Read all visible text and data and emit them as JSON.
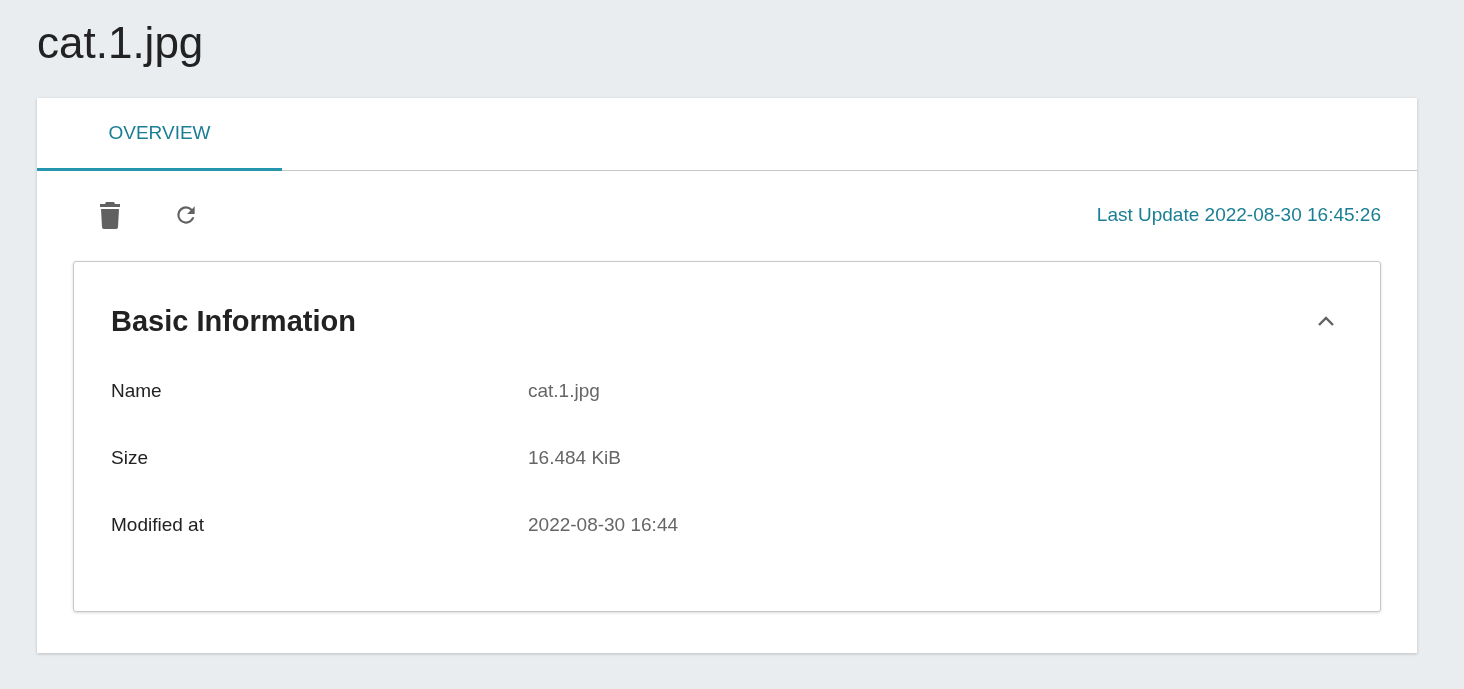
{
  "title": "cat.1.jpg",
  "tabs": [
    {
      "label": "OVERVIEW",
      "selected": true
    }
  ],
  "last_update": "Last Update 2022-08-30 16:45:26",
  "panel": {
    "title": "Basic Information",
    "expanded": true,
    "rows": [
      {
        "label": "Name",
        "value": "cat.1.jpg"
      },
      {
        "label": "Size",
        "value": "16.484 KiB"
      },
      {
        "label": "Modified at",
        "value": "2022-08-30 16:44"
      }
    ]
  }
}
